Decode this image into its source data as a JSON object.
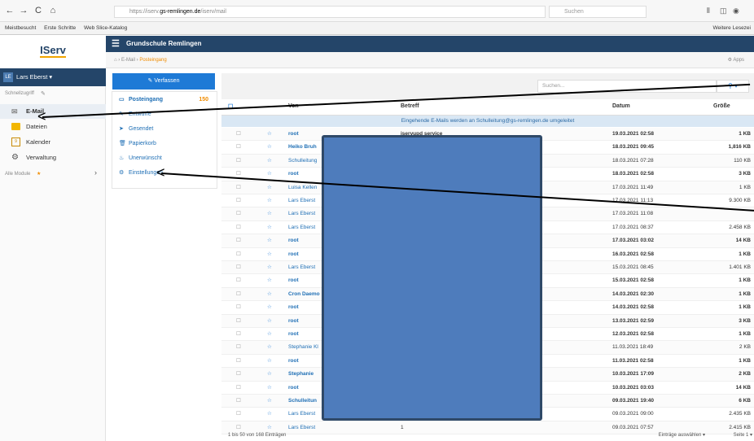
{
  "browser": {
    "back": "←",
    "forward": "→",
    "reload": "C",
    "home": "⌂",
    "url_prefix": "https://iserv.",
    "url_host": "gs-remlingen.de",
    "url_path": "/iserv/mail",
    "search_placeholder": "Suchen",
    "bookmarks": [
      "Meistbesucht",
      "Erste Schritte",
      "Web Slice-Katalog"
    ],
    "other_bookmarks": "Weitere Lesezei"
  },
  "app": {
    "logo_text": "IServ",
    "school_name": "Grundschule Remlingen",
    "breadcrumb": [
      "E-Mail",
      "Posteingang"
    ],
    "apps_label": "Apps",
    "user_initials": "LE",
    "user_name": "Lars Eberst ▾"
  },
  "sidebar": {
    "quick_access": "Schnellzugriff",
    "items": [
      {
        "label": "E-Mail",
        "icon": "envelope-icon"
      },
      {
        "label": "Dateien",
        "icon": "folder-icon"
      },
      {
        "label": "Kalender",
        "icon": "calendar-icon"
      },
      {
        "label": "Verwaltung",
        "icon": "gear-icon"
      }
    ],
    "all_modules": "Alle Module",
    "all_modules_star": "★",
    "chevron": "›"
  },
  "mail": {
    "compose_label": "Verfassen",
    "folders": [
      {
        "label": "Posteingang",
        "count": "150"
      },
      {
        "label": "Entwürfe",
        "count": ""
      },
      {
        "label": "Gesendet",
        "count": ""
      },
      {
        "label": "Papierkorb",
        "count": ""
      },
      {
        "label": "Unerwünscht",
        "count": ""
      },
      {
        "label": "Einstellungen",
        "count": ""
      }
    ],
    "search_placeholder": "Suchen...",
    "columns": {
      "from": "Von",
      "subject": "Betreff",
      "date": "Datum",
      "size": "Größe"
    },
    "notice": "Eingehende E-Mails werden an Schulleitung@gs-remlingen.de umgeleitet",
    "rows": [
      {
        "from": "root",
        "subject": "iservupd service",
        "date": "19.03.2021 02:58",
        "size": "1 KB",
        "bold": true
      },
      {
        "from": "Heiko Bruh",
        "subject": "",
        "date": "18.03.2021 09:45",
        "size": "1,816 KB",
        "bold": true
      },
      {
        "from": "Schulleitung",
        "subject": "",
        "date": "18.03.2021 07:28",
        "size": "110 KB",
        "bold": false
      },
      {
        "from": "root",
        "subject": "",
        "date": "18.03.2021 02:58",
        "size": "3 KB",
        "bold": true
      },
      {
        "from": "Luisa Kellen",
        "subject": "",
        "date": "17.03.2021 11:49",
        "size": "1 KB",
        "bold": false
      },
      {
        "from": "Lars Eberst",
        "subject": "",
        "date": "17.03.2021 11:13",
        "size": "9.300 KB",
        "bold": false
      },
      {
        "from": "Lars Eberst",
        "subject": "",
        "date": "17.03.2021 11:08",
        "size": "",
        "bold": false
      },
      {
        "from": "Lars Eberst",
        "subject": "",
        "date": "17.03.2021 08:37",
        "size": "2.458 KB",
        "bold": false
      },
      {
        "from": "root",
        "subject": "",
        "date": "17.03.2021 03:02",
        "size": "14 KB",
        "bold": true
      },
      {
        "from": "root",
        "subject": "",
        "date": "16.03.2021 02:58",
        "size": "1 KB",
        "bold": true
      },
      {
        "from": "Lars Eberst",
        "subject": "",
        "date": "15.03.2021 08:45",
        "size": "1.401 KB",
        "bold": false
      },
      {
        "from": "root",
        "subject": "",
        "date": "15.03.2021 02:58",
        "size": "1 KB",
        "bold": true
      },
      {
        "from": "Cron Daemo",
        "subject": "",
        "date": "14.03.2021 02:30",
        "size": "1 KB",
        "bold": true
      },
      {
        "from": "root",
        "subject": "",
        "date": "14.03.2021 02:58",
        "size": "1 KB",
        "bold": true
      },
      {
        "from": "root",
        "subject": "",
        "date": "13.03.2021 02:59",
        "size": "3 KB",
        "bold": true
      },
      {
        "from": "root",
        "subject": "",
        "date": "12.03.2021 02:58",
        "size": "1 KB",
        "bold": true
      },
      {
        "from": "Stephanie Kl",
        "subject": "",
        "date": "11.03.2021 18:49",
        "size": "2 KB",
        "bold": false
      },
      {
        "from": "root",
        "subject": "",
        "date": "11.03.2021 02:58",
        "size": "1 KB",
        "bold": true
      },
      {
        "from": "Stephanie",
        "subject": "",
        "date": "10.03.2021 17:09",
        "size": "2 KB",
        "bold": true
      },
      {
        "from": "root",
        "subject": "",
        "date": "10.03.2021 03:03",
        "size": "14 KB",
        "bold": true
      },
      {
        "from": "Schulleitun",
        "subject": "",
        "date": "09.03.2021 19:40",
        "size": "6 KB",
        "bold": true
      },
      {
        "from": "Lars Eberst",
        "subject": "",
        "date": "09.03.2021 09:00",
        "size": "2.435 KB",
        "bold": false
      },
      {
        "from": "Lars Eberst",
        "subject": "1",
        "date": "09.03.2021 07:57",
        "size": "2.415 KB",
        "bold": false
      }
    ],
    "footer_count": "1 bis 50 von 168 Einträgen",
    "footer_select": "Einträge auswählen ▾",
    "footer_page": "Seite 1 ▾"
  }
}
